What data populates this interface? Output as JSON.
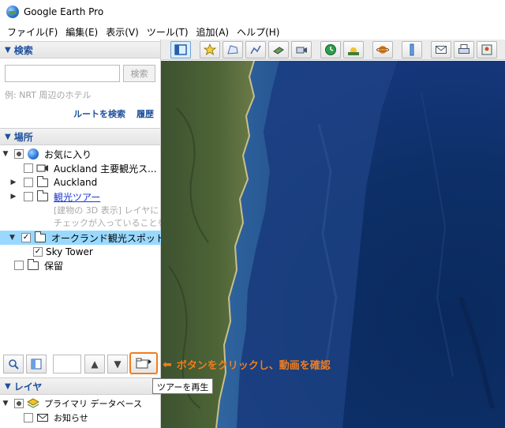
{
  "window": {
    "title": "Google Earth Pro"
  },
  "menu": [
    "ファイル(F)",
    "編集(E)",
    "表示(V)",
    "ツール(T)",
    "追加(A)",
    "ヘルプ(H)"
  ],
  "search": {
    "header": "検索",
    "placeholder": "",
    "button_label": "検索",
    "hint": "例: NRT 周辺のホテル",
    "route_link": "ルートを検索",
    "history_link": "履歴"
  },
  "places": {
    "header": "場所",
    "items": [
      {
        "label": "お気に入り",
        "checked": "partial",
        "icon": "globe-icon"
      },
      {
        "label": "Auckland 主要観光ス...",
        "checked": false,
        "icon": "tour-icon"
      },
      {
        "label": "Auckland",
        "checked": false,
        "icon": "folder-icon"
      },
      {
        "label": "観光ツアー",
        "checked": false,
        "icon": "folder-icon",
        "link": true
      },
      {
        "label": "[建物の 3D 表示] レイヤに",
        "gray": true
      },
      {
        "label": "チェックが入っていることを確",
        "gray": true
      },
      {
        "label": "オークランド観光スポット",
        "checked": true,
        "icon": "folder-open-icon",
        "selected": true
      },
      {
        "label": "Sky Tower",
        "checked": true
      },
      {
        "label": "保留",
        "checked": false,
        "icon": "folder-icon"
      }
    ]
  },
  "layers": {
    "header": "レイヤ",
    "items": [
      {
        "label": "プライマリ データベース"
      },
      {
        "label": "お知らせ"
      }
    ]
  },
  "annotation": "ボタンをクリックし、動画を確認",
  "tooltip": "ツアーを再生",
  "colors": {
    "accent": "#f07d1e",
    "header_text": "#1c4f9c",
    "selected_row": "#99d9ff"
  }
}
